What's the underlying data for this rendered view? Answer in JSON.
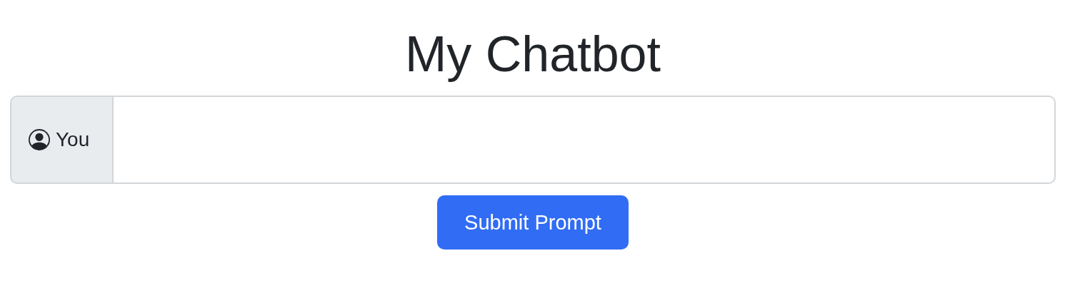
{
  "title": "My Chatbot",
  "prompt": {
    "label": "You"
  },
  "button": "Submit Prompt"
}
